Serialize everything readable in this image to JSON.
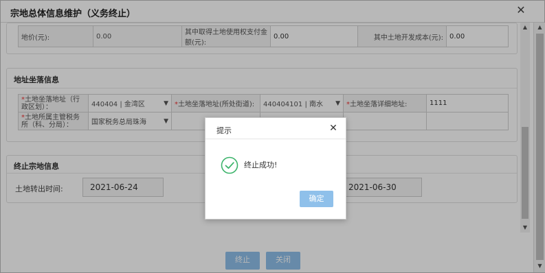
{
  "window": {
    "title": "宗地总体信息维护（义务终止）",
    "close_glyph": "✕"
  },
  "price_row": {
    "land_price_label": "地价(元):",
    "land_price_value": "0.00",
    "acquire_cost_label": "其中取得土地使用权支付金额(元):",
    "acquire_cost_value": "0.00",
    "develop_cost_label": "其中土地开发成本(元):",
    "develop_cost_value": "0.00"
  },
  "location": {
    "section_title": "地址坐落信息",
    "district_label": "土地坐落地址（行政区划）：",
    "district_value": "440404 | 金湾区",
    "street_label": "土地坐落地址(所处街道):",
    "street_value": "440404101 | 南水",
    "detail_label": "土地坐落详细地址:",
    "detail_value": "1111",
    "tax_office_label": "土地所属主管税务所（科、分局）：",
    "tax_office_value": "国家税务总局珠海",
    "required_mark": "*"
  },
  "terminate": {
    "section_title": "终止宗地信息",
    "transfer_time_label": "土地转出时间:",
    "transfer_time_value": "2021-06-24",
    "second_date_value": "2021-06-30"
  },
  "buttons": {
    "terminate": "终止",
    "close": "关闭"
  },
  "modal": {
    "title": "提示",
    "close_glyph": "✕",
    "message": "终止成功!",
    "confirm": "确定"
  },
  "colors": {
    "accent": "#8fc0ea",
    "success": "#3bb36a",
    "required": "#e33333"
  },
  "icons": {
    "success": "check-circle-icon",
    "close": "close-icon",
    "chevron": "chevron-down-icon"
  }
}
